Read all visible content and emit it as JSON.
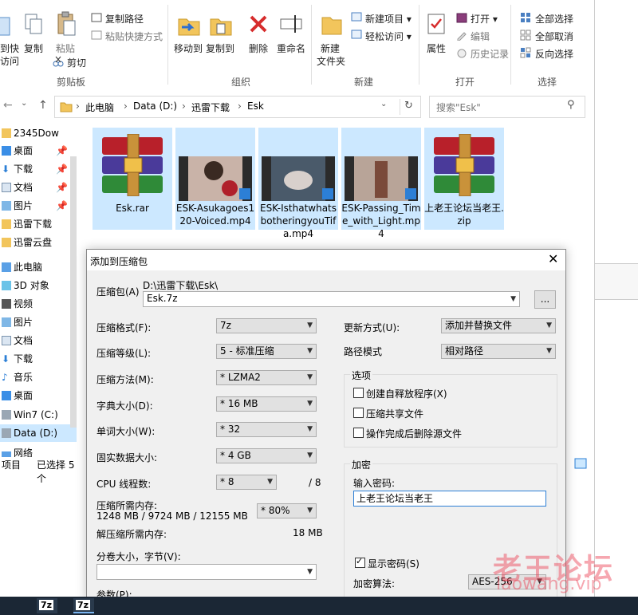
{
  "ribbon": {
    "groups": {
      "clipboard": "剪贴板",
      "organize": "组织",
      "new": "新建",
      "open": "打开",
      "select": "选择"
    },
    "pin_partial_1": "到快",
    "pin_partial_2": "访问",
    "copy": "复制",
    "paste": "粘贴",
    "copy_path": "复制路径",
    "paste_shortcut": "粘贴快捷方式",
    "cut": "剪切",
    "move_to": "移动到",
    "copy_to": "复制到",
    "delete": "删除",
    "rename": "重命名",
    "new_folder_1": "新建",
    "new_folder_2": "文件夹",
    "new_item": "新建项目 ▾",
    "easy_access": "轻松访问 ▾",
    "properties": "属性",
    "open": "打开 ▾",
    "edit": "编辑",
    "history": "历史记录",
    "select_all": "全部选择",
    "select_none": "全部取消",
    "invert": "反向选择"
  },
  "address": {
    "path": [
      "此电脑",
      "Data (D:)",
      "迅雷下载",
      "Esk"
    ],
    "search_placeholder": "搜索\"Esk\""
  },
  "nav": [
    {
      "label": "2345Dow",
      "icon": "folder-icon"
    },
    {
      "label": "桌面",
      "icon": "desktop-icon"
    },
    {
      "label": "下载",
      "icon": "download-icon"
    },
    {
      "label": "文档",
      "icon": "document-icon"
    },
    {
      "label": "图片",
      "icon": "picture-icon"
    },
    {
      "label": "迅雷下载",
      "icon": "folder-icon"
    },
    {
      "label": "迅雷云盘",
      "icon": "folder-icon"
    },
    {
      "label": "此电脑",
      "icon": "pc-icon"
    },
    {
      "label": "3D 对象",
      "icon": "cube-icon"
    },
    {
      "label": "视频",
      "icon": "video-icon"
    },
    {
      "label": "图片",
      "icon": "picture-icon"
    },
    {
      "label": "文档",
      "icon": "document-icon"
    },
    {
      "label": "下载",
      "icon": "download-icon"
    },
    {
      "label": "音乐",
      "icon": "music-icon"
    },
    {
      "label": "桌面",
      "icon": "desktop-icon"
    },
    {
      "label": "Win7 (C:)",
      "icon": "drive-icon"
    },
    {
      "label": "Data (D:)",
      "icon": "drive-icon"
    },
    {
      "label": "网络",
      "icon": "network-icon"
    }
  ],
  "files": [
    {
      "name": "Esk.rar",
      "type": "rar"
    },
    {
      "name": "ESK-Asukagoes120-Voiced.mp4",
      "type": "video"
    },
    {
      "name": "ESK-IsthatwhatsbotheringyouTifa.mp4",
      "type": "video"
    },
    {
      "name": "ESK-Passing_Time_with_Light.mp4",
      "type": "video"
    },
    {
      "name": "上老王论坛当老王.zip",
      "type": "rar"
    }
  ],
  "status": {
    "items": "项目",
    "selected": "已选择 5 个"
  },
  "dialog": {
    "title": "添加到压缩包",
    "archive_label": "压缩包(A)",
    "archive_dir": "D:\\迅雷下载\\Esk\\",
    "archive_name": "Esk.7z",
    "browse": "...",
    "format_label": "压缩格式(F):",
    "format": "7z",
    "level_label": "压缩等级(L):",
    "level": "5 - 标准压缩",
    "method_label": "压缩方法(M):",
    "method": "* LZMA2",
    "dict_label": "字典大小(D):",
    "dict": "* 16 MB",
    "word_label": "单词大小(W):",
    "word": "* 32",
    "solid_label": "固实数据大小:",
    "solid": "* 4 GB",
    "threads_label": "CPU 线程数:",
    "threads": "* 8",
    "threads_max": "/ 8",
    "mem_comp_label": "压缩所需内存:",
    "mem_comp_values": "1248 MB / 9724 MB / 12155 MB",
    "mem_percent": "* 80%",
    "mem_decomp_label": "解压缩所需内存:",
    "mem_decomp": "18 MB",
    "volume_label": "分卷大小，字节(V):",
    "volume": "",
    "params_label": "参数(P):",
    "update_label": "更新方式(U):",
    "update": "添加并替换文件",
    "path_mode_label": "路径模式",
    "path_mode": "相对路径",
    "options_title": "选项",
    "opt_sfx": "创建自释放程序(X)",
    "opt_shared": "压缩共享文件",
    "opt_delete": "操作完成后删除源文件",
    "enc_title": "加密",
    "pwd_label": "输入密码:",
    "pwd": "上老王论坛当老王",
    "show_pwd": "显示密码(S)",
    "enc_method_label": "加密算法:",
    "enc_method": "AES-256"
  },
  "watermark": {
    "cn": "老王论坛",
    "en": "laowang.vip"
  },
  "taskbar": {
    "item1": "7z",
    "item2": "7z"
  }
}
